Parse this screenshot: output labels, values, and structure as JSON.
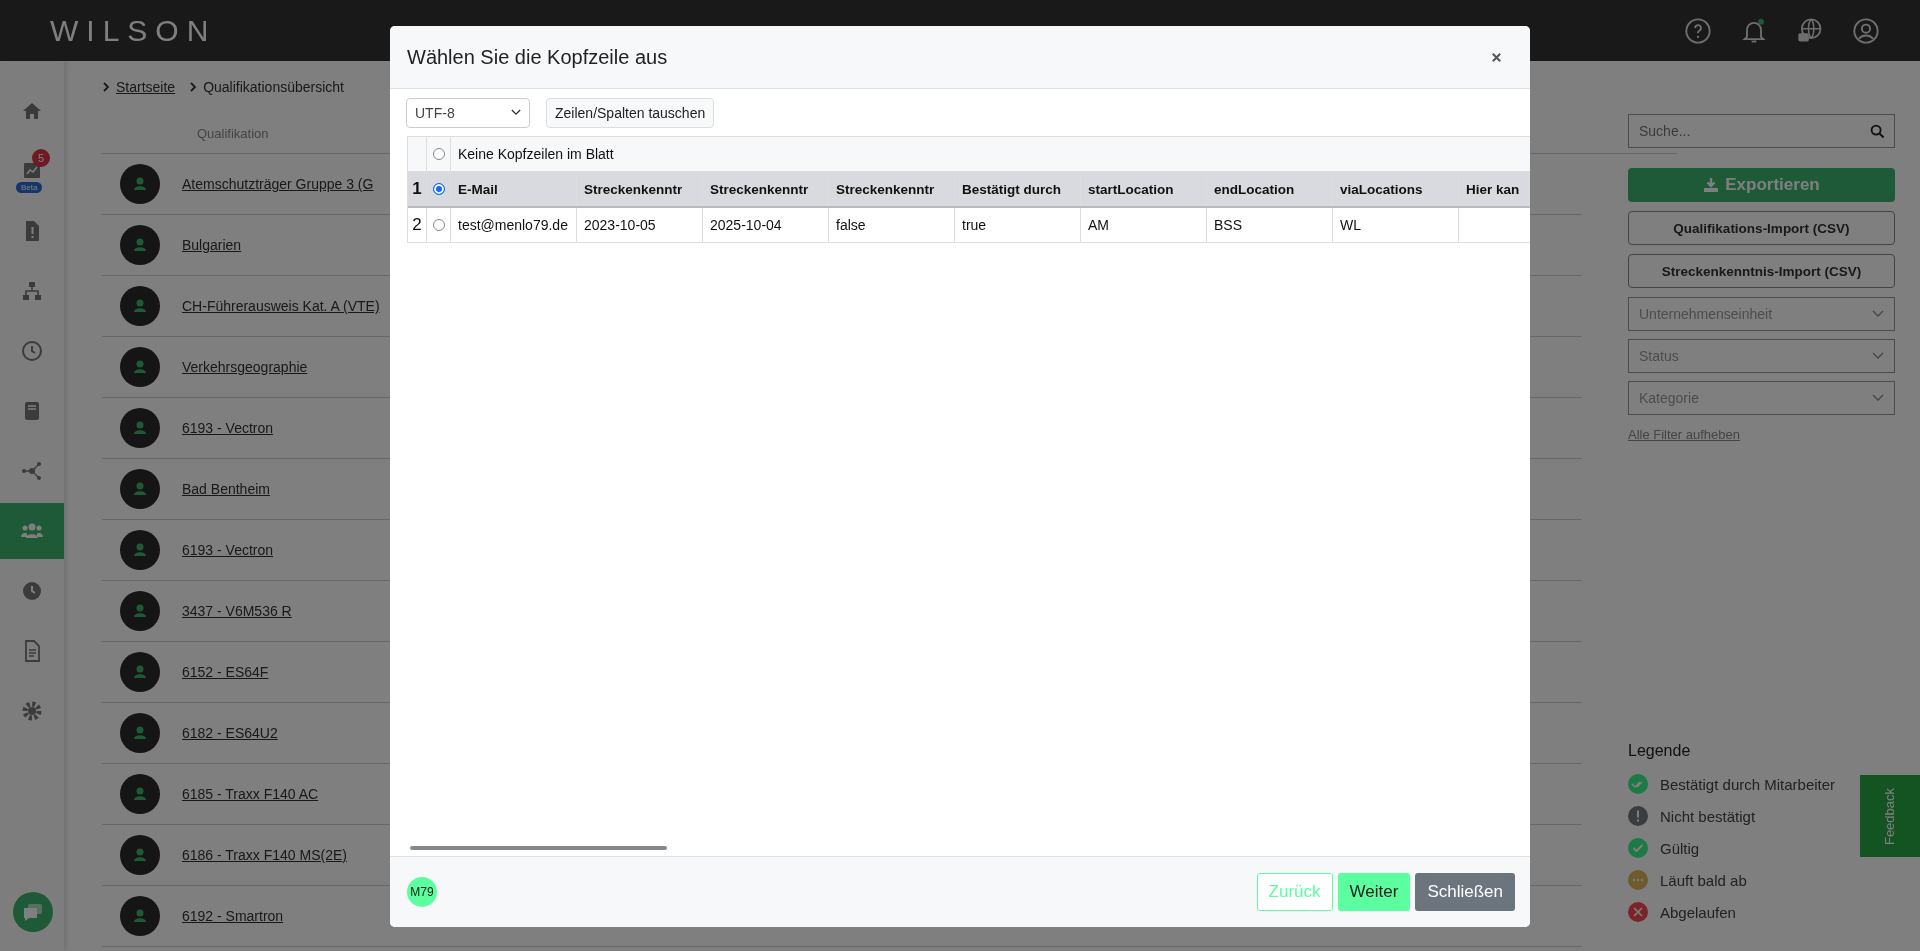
{
  "header": {
    "logo": "WILSON",
    "notification_dot": true
  },
  "sidebar": {
    "items": [
      {
        "selected": false
      },
      {
        "selected": false,
        "badge": "5",
        "tag": "Beta"
      },
      {
        "selected": false
      },
      {
        "selected": false
      },
      {
        "selected": false
      },
      {
        "selected": false
      },
      {
        "selected": false
      },
      {
        "selected": true
      },
      {
        "selected": false
      },
      {
        "selected": false
      },
      {
        "selected": false
      }
    ]
  },
  "breadcrumb": [
    "Startseite",
    "Qualifikationsübersicht"
  ],
  "list": {
    "column": "Qualifikation",
    "rows": [
      "Atemschutzträger Gruppe 3 (G",
      "Bulgarien",
      "CH-Führerausweis Kat. A (VTE)",
      "Verkehrsgeographie",
      "6193 - Vectron",
      "Bad Bentheim",
      "6193 - Vectron",
      "3437 - V6M536 R",
      "6152 - ES64F",
      "6182 - ES64U2",
      "6185 - Traxx F140 AC",
      "6186 - Traxx F140 MS(2E)",
      "6192 - Smartron"
    ]
  },
  "filters": {
    "search": {
      "placeholder": "Suche..."
    },
    "export_button": "Exportieren",
    "import_buttons": [
      "Qualifikations-Import (CSV)",
      "Streckenkenntnis-Import (CSV)"
    ],
    "selects": [
      {
        "placeholder": "Unternehmenseinheit"
      },
      {
        "placeholder": "Status"
      },
      {
        "placeholder": "Kategorie"
      }
    ],
    "clear_link": "Alle Filter aufheben"
  },
  "legend": {
    "title": "Legende",
    "items": [
      {
        "kind": "double-check",
        "label": "Bestätigt durch Mitarbeiter",
        "color": "#1e7a44"
      },
      {
        "kind": "exclamation",
        "label": "Nicht bestätigt",
        "color": "#3a3d40"
      },
      {
        "kind": "check",
        "label": "Gültig",
        "color": "#1e7a44"
      },
      {
        "kind": "dots",
        "label": "Läuft bald ab",
        "color": "#6e5a2a"
      },
      {
        "kind": "cross",
        "label": "Abgelaufen",
        "color": "#7a2428"
      }
    ]
  },
  "feedback": "Feedback",
  "modal": {
    "title": "Wählen Sie die Kopfzeile aus",
    "encoding": "UTF-8",
    "swap_button": "Zeilen/Spalten tauschen",
    "table": {
      "no_header": {
        "label": "Keine Kopfzeilen im Blatt",
        "selected": false
      },
      "rows": [
        {
          "number": "1",
          "selected": true,
          "cells": [
            "E-Mail",
            "Streckenkenntr",
            "Streckenkenntr",
            "Streckenkenntr",
            "Bestätigt durch",
            "startLocation",
            "endLocation",
            "viaLocations",
            "Hier kan"
          ]
        },
        {
          "number": "2",
          "selected": false,
          "cells": [
            "test@menlo79.de",
            "2023-10-05",
            "2025-10-04",
            "false",
            "true",
            "AM",
            "BSS",
            "WL"
          ]
        }
      ]
    },
    "footer": {
      "logo": "M79",
      "buttons": [
        {
          "kind": "outline",
          "label": "Zurück"
        },
        {
          "kind": "primary",
          "label": "Weiter"
        },
        {
          "kind": "secondary",
          "label": "Schließen"
        }
      ]
    }
  }
}
